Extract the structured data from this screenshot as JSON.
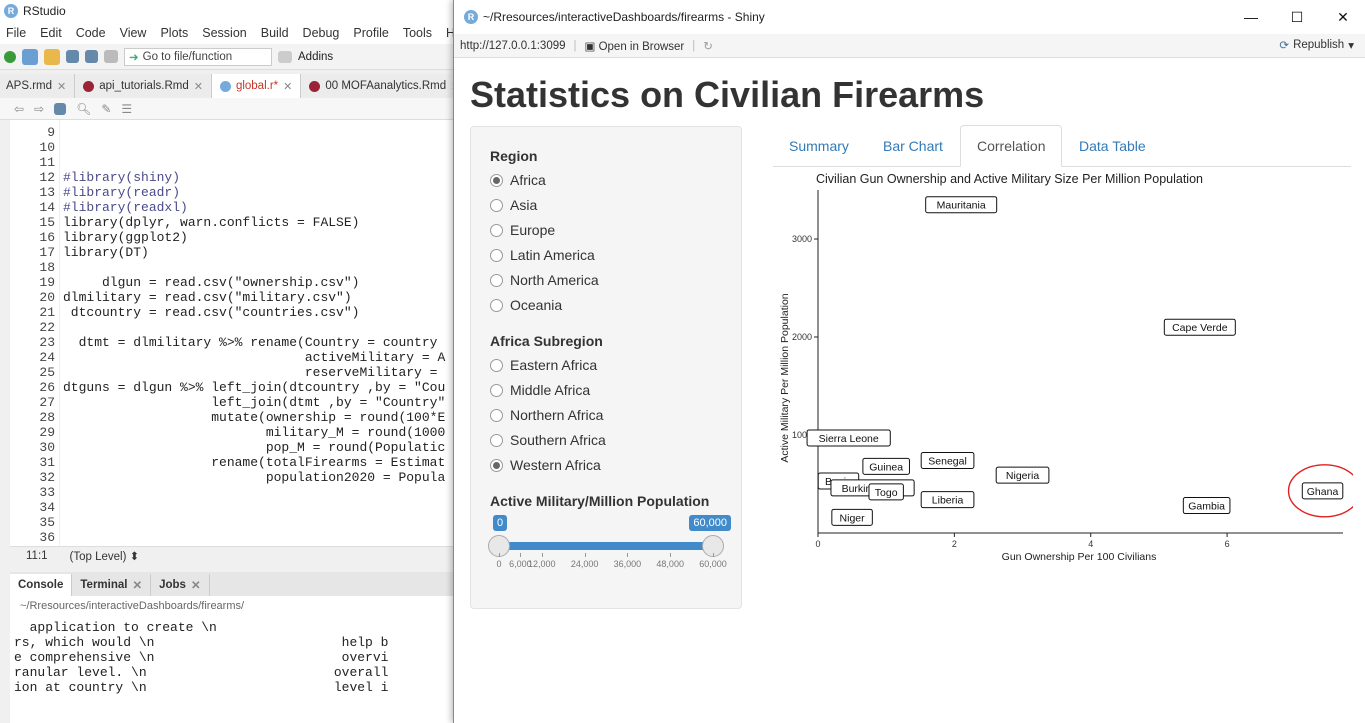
{
  "rstudio": {
    "title": "RStudio",
    "menu": [
      "File",
      "Edit",
      "Code",
      "View",
      "Plots",
      "Session",
      "Build",
      "Debug",
      "Profile",
      "Tools",
      "H"
    ],
    "goto_placeholder": "Go to file/function",
    "addins": "Addins",
    "tabs": [
      {
        "label": "APS.rmd",
        "active": false
      },
      {
        "label": "api_tutorials.Rmd",
        "active": false
      },
      {
        "label": "global.r*",
        "active": true
      },
      {
        "label": "00 MOFAanalytics.Rmd",
        "active": false
      }
    ],
    "line_numbers": [
      "9",
      "10",
      "11",
      "12",
      "13",
      "14",
      "15",
      "16",
      "17",
      "18",
      "19",
      "20",
      "21",
      "22",
      "23",
      "24",
      "25",
      "26",
      "27",
      "28",
      "29",
      "30",
      "31",
      "32",
      "33",
      "34",
      "35",
      "36"
    ],
    "code": [
      "",
      "",
      "",
      "#library(shiny)",
      "#library(readr)",
      "#library(readxl)",
      "library(dplyr, warn.conflicts = FALSE)",
      "library(ggplot2)",
      "library(DT)",
      "",
      "     dlgun = read.csv(\"ownership.csv\")",
      "dlmilitary = read.csv(\"military.csv\")",
      " dtcountry = read.csv(\"countries.csv\")",
      "",
      "  dtmt = dlmilitary %>% rename(Country = country",
      "                               activeMilitary = A",
      "                               reserveMilitary =",
      "dtguns = dlgun %>% left_join(dtcountry ,by = \"Cou",
      "                   left_join(dtmt ,by = \"Country\"",
      "                   mutate(ownership = round(100*E",
      "                          military_M = round(1000",
      "                          pop_M = round(Populatic",
      "                   rename(totalFirearms = Estimat",
      "                          population2020 = Popula",
      "",
      "",
      "",
      ""
    ],
    "status_pos": "11:1",
    "status_scope": "(Top Level)",
    "console_tabs": [
      "Console",
      "Terminal",
      "Jobs"
    ],
    "console_path": "~/Rresources/interactiveDashboards/firearms/",
    "console_lines": [
      "  application to create \\n",
      "rs, which would \\n                        help b",
      "e comprehensive \\n                        overvi",
      "ranular level. \\n                        overall",
      "ion at country \\n                        level i"
    ]
  },
  "shiny": {
    "window_title": "~/Rresources/interactiveDashboards/firearms - Shiny",
    "url": "http://127.0.0.1:3099",
    "open_browser": "Open in Browser",
    "publish": "Republish",
    "app_title": "Statistics on Civilian Firearms",
    "region_label": "Region",
    "regions": [
      {
        "label": "Africa",
        "checked": true
      },
      {
        "label": "Asia",
        "checked": false
      },
      {
        "label": "Europe",
        "checked": false
      },
      {
        "label": "Latin America",
        "checked": false
      },
      {
        "label": "North America",
        "checked": false
      },
      {
        "label": "Oceania",
        "checked": false
      }
    ],
    "subregion_label": "Africa Subregion",
    "subregions": [
      {
        "label": "Eastern Africa",
        "checked": false
      },
      {
        "label": "Middle Africa",
        "checked": false
      },
      {
        "label": "Northern Africa",
        "checked": false
      },
      {
        "label": "Southern Africa",
        "checked": false
      },
      {
        "label": "Western Africa",
        "checked": true
      }
    ],
    "slider": {
      "label": "Active Military/Million Population",
      "min_value": "0",
      "max_value": "60,000",
      "range": [
        0,
        60000
      ],
      "selected": [
        0,
        60000
      ],
      "ticks": [
        "0",
        "6,000",
        "12,000",
        "24,000",
        "36,000",
        "48,000",
        "60,000"
      ]
    },
    "tabs": [
      {
        "label": "Summary",
        "active": false
      },
      {
        "label": "Bar Chart",
        "active": false
      },
      {
        "label": "Correlation",
        "active": true
      },
      {
        "label": "Data Table",
        "active": false
      }
    ]
  },
  "chart_data": {
    "type": "scatter",
    "title": "Civilian Gun Ownership and Active Military Size Per Million Population",
    "xlabel": "Gun Ownership Per 100 Civilians",
    "ylabel": "Active Military Per Million Population",
    "xlim": [
      0,
      7.7
    ],
    "ylim": [
      0,
      3500
    ],
    "xticks": [
      0,
      2,
      4,
      6
    ],
    "yticks": [
      1000,
      2000,
      3000
    ],
    "points": [
      {
        "label": "Mauritania",
        "x": 2.1,
        "y": 3350
      },
      {
        "label": "Cape Verde",
        "x": 5.6,
        "y": 2100
      },
      {
        "label": "Sierra Leone",
        "x": 0.45,
        "y": 970
      },
      {
        "label": "Senegal",
        "x": 1.9,
        "y": 740
      },
      {
        "label": "Guinea",
        "x": 1.0,
        "y": 680
      },
      {
        "label": "Nigeria",
        "x": 3.0,
        "y": 590
      },
      {
        "label": "Benin",
        "x": 0.3,
        "y": 530
      },
      {
        "label": "Burkina Faso",
        "x": 0.8,
        "y": 460
      },
      {
        "label": "Togo",
        "x": 1.0,
        "y": 420
      },
      {
        "label": "Liberia",
        "x": 1.9,
        "y": 340
      },
      {
        "label": "Gambia",
        "x": 5.7,
        "y": 280
      },
      {
        "label": "Ghana",
        "x": 7.4,
        "y": 430
      },
      {
        "label": "Niger",
        "x": 0.5,
        "y": 160
      }
    ],
    "highlight": "Ghana",
    "grid": false
  }
}
